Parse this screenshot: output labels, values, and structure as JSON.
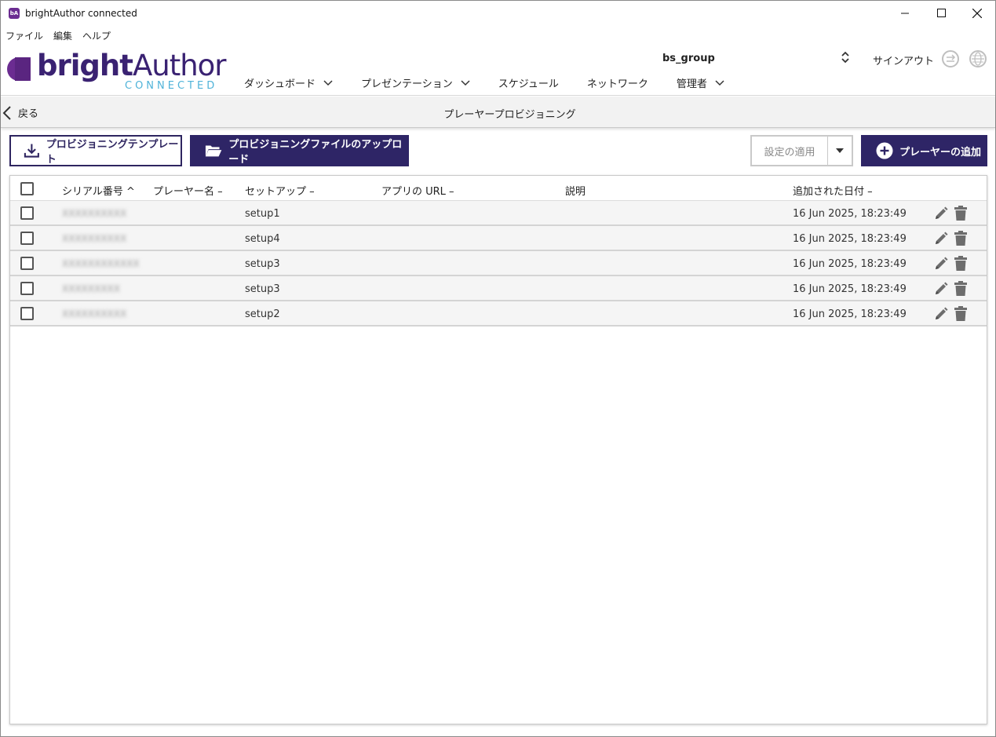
{
  "window": {
    "title": "brightAuthor connected",
    "icon_text": "bA"
  },
  "menubar": {
    "items": [
      "ファイル",
      "編集",
      "ヘルプ"
    ]
  },
  "header": {
    "logo_bold": "bright",
    "logo_light": "Author",
    "logo_sub": "CONNECTED",
    "group_name": "bs_group",
    "signout": "サインアウト",
    "nav": [
      {
        "label": "ダッシュボード",
        "has_dropdown": true
      },
      {
        "label": "プレゼンテーション",
        "has_dropdown": true
      },
      {
        "label": "スケジュール",
        "has_dropdown": false
      },
      {
        "label": "ネットワーク",
        "has_dropdown": false
      },
      {
        "label": "管理者",
        "has_dropdown": true
      }
    ]
  },
  "subheader": {
    "back_label": "戻る",
    "title": "プレーヤープロビジョニング"
  },
  "toolbar": {
    "template_label": "プロビジョニングテンプレート",
    "upload_label": "プロビジョニングファイルのアップロード",
    "apply_label": "設定の適用",
    "add_label": "プレーヤーの追加"
  },
  "table": {
    "columns": {
      "serial": "シリアル番号 ^",
      "player_name": "プレーヤー名 –",
      "setup": "セットアップ –",
      "app_url": "アプリの URL –",
      "description": "説明",
      "date_added": "追加された日付 –"
    },
    "rows": [
      {
        "serial": "XXXXXXXXXX",
        "player_name": "",
        "setup": "setup1",
        "app_url": "",
        "description": "",
        "date_added": "16 Jun 2025, 18:23:49"
      },
      {
        "serial": "XXXXXXXXXX",
        "player_name": "",
        "setup": "setup4",
        "app_url": "",
        "description": "",
        "date_added": "16 Jun 2025, 18:23:49"
      },
      {
        "serial": "XXXXXXXXXXXX",
        "player_name": "",
        "setup": "setup3",
        "app_url": "",
        "description": "",
        "date_added": "16 Jun 2025, 18:23:49"
      },
      {
        "serial": "XXXXXXXXX",
        "player_name": "",
        "setup": "setup3",
        "app_url": "",
        "description": "",
        "date_added": "16 Jun 2025, 18:23:49"
      },
      {
        "serial": "XXXXXXXXXX",
        "player_name": "",
        "setup": "setup2",
        "app_url": "",
        "description": "",
        "date_added": "16 Jun 2025, 18:23:49"
      }
    ]
  },
  "colors": {
    "brand_dark": "#2e2566",
    "logo_purple": "#6b2c91",
    "logo_sub": "#4fb3d9"
  }
}
